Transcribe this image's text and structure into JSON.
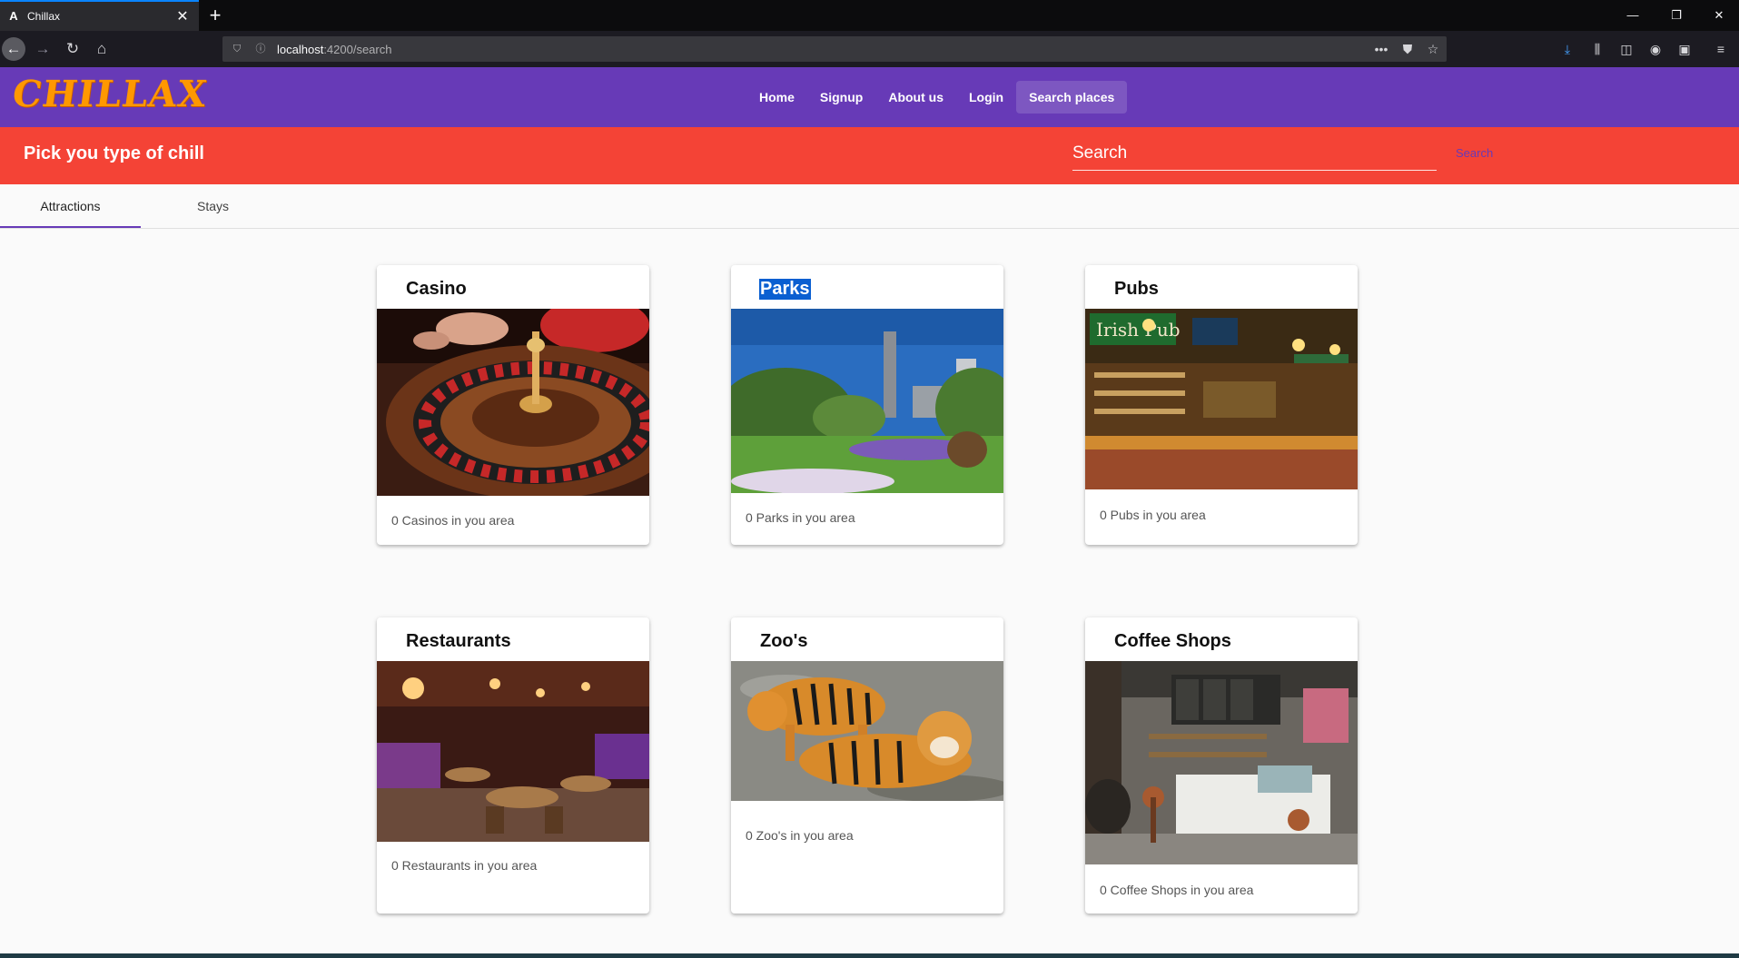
{
  "browser": {
    "tab_title": "Chillax",
    "tab_favicon": "A",
    "url_host": "localhost",
    "url_path": ":4200/search"
  },
  "app": {
    "logo": "CHILLAX",
    "nav": [
      "Home",
      "Signup",
      "About us",
      "Login",
      "Search places"
    ],
    "active_nav": "Search places"
  },
  "toolbar": {
    "title": "Pick you type of chill",
    "search_placeholder": "Search",
    "search_button": "Search"
  },
  "tabs": [
    "Attractions",
    "Stays"
  ],
  "cards": [
    {
      "title": "Casino",
      "subtitle": "0 Casinos in you area",
      "image": "roulette-wheel-photo"
    },
    {
      "title": "Parks",
      "subtitle": "0 Parks in you area",
      "image": "park-garden-photo"
    },
    {
      "title": "Pubs",
      "subtitle": "0 Pubs in you area",
      "image": "irish-pub-bar-photo"
    },
    {
      "title": "Restaurants",
      "subtitle": "0 Restaurants in you area",
      "image": "restaurant-interior-photo"
    },
    {
      "title": "Zoo's",
      "subtitle": "0 Zoo's in you area",
      "image": "tigers-photo"
    },
    {
      "title": "Coffee Shops",
      "subtitle": "0 Coffee Shops in you area",
      "image": "coffee-shop-interior-photo"
    }
  ],
  "colors": {
    "primary": "#673ab7",
    "accent_bar": "#f44336",
    "logo": "#ff9800"
  }
}
